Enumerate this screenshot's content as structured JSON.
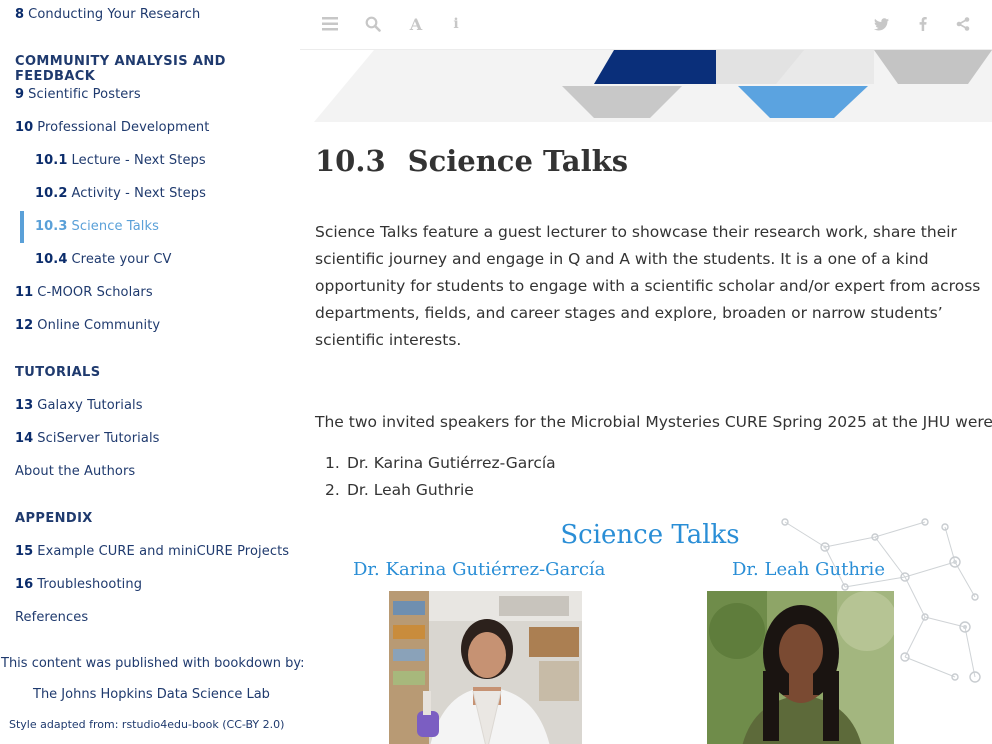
{
  "sidebar": {
    "items": [
      {
        "num": "8",
        "label": "Conducting Your Research"
      },
      {
        "num": "9",
        "label": "Scientific Posters"
      },
      {
        "num": "10",
        "label": "Professional Development"
      },
      {
        "num": "10.1",
        "label": "Lecture - Next Steps"
      },
      {
        "num": "10.2",
        "label": "Activity - Next Steps"
      },
      {
        "num": "10.3",
        "label": "Science Talks"
      },
      {
        "num": "10.4",
        "label": "Create your CV"
      },
      {
        "num": "11",
        "label": "C-MOOR Scholars"
      },
      {
        "num": "12",
        "label": "Online Community"
      },
      {
        "num": "13",
        "label": "Galaxy Tutorials"
      },
      {
        "num": "14",
        "label": "SciServer Tutorials"
      },
      {
        "num": "",
        "label": "About the Authors"
      },
      {
        "num": "15",
        "label": "Example CURE and miniCURE Projects"
      },
      {
        "num": "16",
        "label": "Troubleshooting"
      },
      {
        "num": "",
        "label": "References"
      }
    ],
    "headers": {
      "community": "COMMUNITY ANALYSIS AND FEEDBACK",
      "tutorials": "TUTORIALS",
      "appendix": "APPENDIX"
    },
    "published_by": "This content was published with bookdown by:",
    "lab": "The Johns Hopkins Data Science Lab",
    "style_credit": "Style adapted from: rstudio4edu-book (CC-BY 2.0)"
  },
  "toolbar": {
    "icons": [
      "menu-icon",
      "search-icon",
      "font-icon",
      "info-icon",
      "twitter-icon",
      "facebook-icon",
      "share-icon"
    ]
  },
  "main": {
    "section_number": "10.3",
    "section_title": "Science Talks",
    "intro": "Science Talks feature a guest lecturer to showcase their research work, share their scientific journey and engage in Q and A with the students. It is a one of a kind opportunity for students to engage with a scientific scholar and/or expert from across departments, fields, and career stages and explore, broaden or narrow students’ scientific interests.",
    "speakers_intro": "The two invited speakers for the Microbial Mysteries CURE Spring 2025 at the JHU were:",
    "speakers": [
      {
        "n": "1.",
        "name": "Dr. Karina Gutiérrez-García"
      },
      {
        "n": "2.",
        "name": "Dr. Leah Guthrie"
      }
    ]
  },
  "figure": {
    "title": "Science Talks",
    "speaker1": "Dr. Karina Gutiérrez-García",
    "speaker2": "Dr. Leah Guthrie"
  },
  "colors": {
    "nav_text": "#1f3a6e",
    "active": "#5aa0d8",
    "figure_blue": "#2a8ed6",
    "banner_navy": "#0a2f7a"
  }
}
